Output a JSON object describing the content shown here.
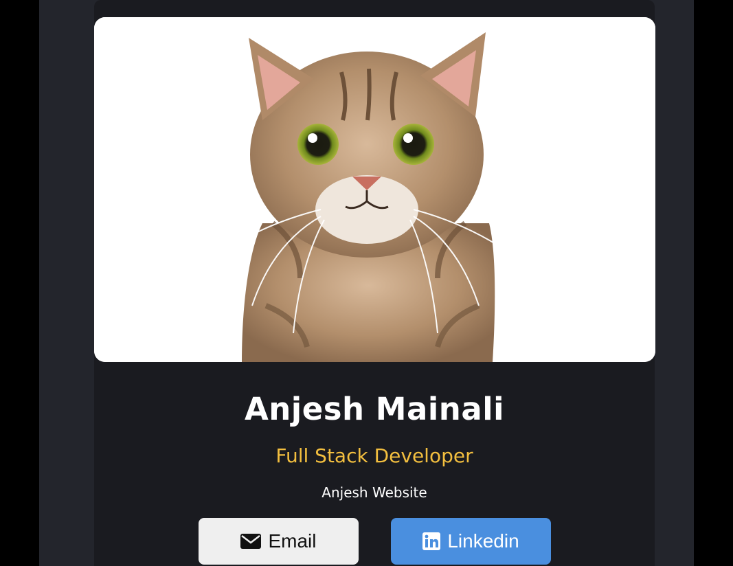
{
  "profile": {
    "name": "Anjesh Mainali",
    "role": "Full Stack Developer",
    "website_label": "Anjesh Website",
    "photo_icon": "cat-photo"
  },
  "buttons": {
    "email": {
      "label": "Email",
      "icon": "envelope-icon"
    },
    "linkedin": {
      "label": "Linkedin",
      "icon": "linkedin-icon"
    }
  },
  "colors": {
    "background": "#000000",
    "page": "#23252c",
    "card": "#1a1b20",
    "role_text": "#f3bf3f",
    "email_button": "#efefef",
    "linkedin_button": "#4a8fdf"
  }
}
